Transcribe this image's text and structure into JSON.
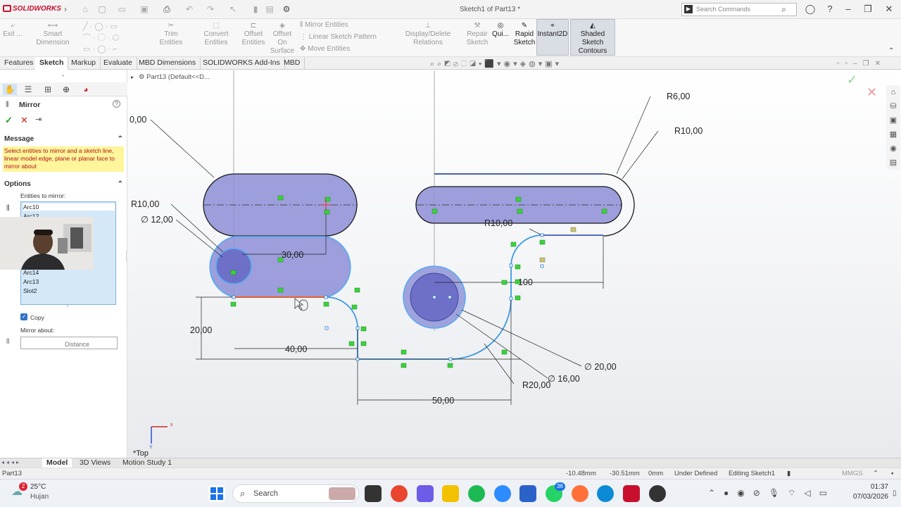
{
  "titlebar": {
    "logo": "SOLIDWORKS",
    "doc_title": "Sketch1 of Part13 *",
    "search_placeholder": "Search Commands"
  },
  "commands": {
    "exit": "Exit ...",
    "smart_dimension": "Smart Dimension",
    "trim": "Trim Entities",
    "convert": "Convert Entities",
    "offset_l1": "Offset",
    "offset_l2": "Entities",
    "offset_surf_l1": "Offset On",
    "offset_surf_l2": "Surface",
    "mirror_entities": "Mirror Entities",
    "linear_pattern": "Linear Sketch Pattern",
    "move_entities": "Move Entities",
    "display_relations": "Display/Delete Relations",
    "repair_l1": "Repair",
    "repair_l2": "Sketch",
    "quick": "Qui...",
    "rapid_l1": "Rapid",
    "rapid_l2": "Sketch",
    "instant2d": "Instant2D",
    "shaded_l1": "Shaded Sketch",
    "shaded_l2": "Contours"
  },
  "tabs": [
    "Features",
    "Sketch",
    "Markup",
    "Evaluate",
    "MBD Dimensions",
    "SOLIDWORKS Add-Ins",
    "MBD"
  ],
  "active_tab": "Sketch",
  "property_manager": {
    "title": "Mirror",
    "message_header": "Message",
    "message": "Select entities to mirror and a sketch line, linear model edge, plane or planar face to mirror about",
    "options_header": "Options",
    "entities_label": "Entities to mirror:",
    "entities": [
      "Arc10",
      "Arc12",
      "Arc14",
      "Arc13",
      "Slot2"
    ],
    "copy_label": "Copy",
    "copy_checked": true,
    "mirror_about_label": "Mirror about:",
    "distance_label": "Distance"
  },
  "canvas": {
    "tree_label": "Part13  (Default<<D...",
    "view_label": "*Top",
    "dims": {
      "d1": "0,00",
      "d2": "R10,00",
      "d3": "∅ 12,00",
      "d4": "30,00",
      "d5": "20,00",
      "d6": "40,00",
      "d7": "R10,00",
      "d8": "R6,00",
      "d9": "R10,00",
      "d10": "100",
      "d11": "∅ 20,00",
      "d12": "∅ 16,00",
      "d13": "R20,00",
      "d14": "50,00"
    }
  },
  "bottom_tabs": [
    "Model",
    "3D Views",
    "Motion Study 1"
  ],
  "active_bottom_tab": "Model",
  "status": {
    "part": "Part13",
    "x": "-10.48mm",
    "y": "-30.51mm",
    "z": "0mm",
    "state": "Under Defined",
    "mode": "Editing Sketch1",
    "units": "MMGS"
  },
  "taskbar": {
    "temp": "25°C",
    "weather": "Hujan",
    "weather_badge": "2",
    "search": "Search",
    "whatsapp_badge": "36",
    "time": "01:37",
    "date": "07/03/2026"
  },
  "colors": {
    "sketch_blue": "#3b9be0",
    "slot_fill": "#8d8ed6",
    "selection": "#cfe6f7",
    "message_bg": "#fff59a",
    "accent_red": "#c8102e"
  }
}
